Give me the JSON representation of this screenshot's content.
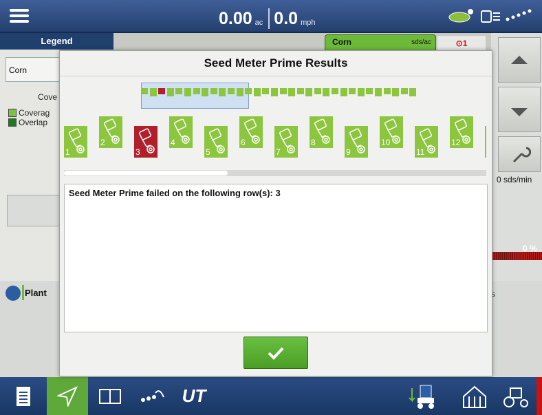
{
  "topbar": {
    "area_value": "0.00",
    "area_unit": "ac",
    "speed_value": "0.0",
    "speed_unit": "mph"
  },
  "left_panel": {
    "legend_title": "Legend",
    "crop_button": "Corn",
    "coverage_header": "Cove",
    "legend_items": [
      {
        "label": "Coverag",
        "color": "#7cc23c"
      },
      {
        "label": "Overlap",
        "color": "#1c7a1f"
      }
    ],
    "plant_label": "Plant"
  },
  "right_panel": {
    "crop_tab": "Corn",
    "crop_unit": "sds/ac",
    "pin_label": "1",
    "rate": "0 sds/min",
    "percent": "0 %",
    "s_letter": "s"
  },
  "modal": {
    "title": "Seed Meter Prime Results",
    "rows": [
      {
        "num": "1",
        "status": "ok"
      },
      {
        "num": "2",
        "status": "ok"
      },
      {
        "num": "3",
        "status": "fail"
      },
      {
        "num": "4",
        "status": "ok"
      },
      {
        "num": "5",
        "status": "ok"
      },
      {
        "num": "6",
        "status": "ok"
      },
      {
        "num": "7",
        "status": "ok"
      },
      {
        "num": "8",
        "status": "ok"
      },
      {
        "num": "9",
        "status": "ok"
      },
      {
        "num": "10",
        "status": "ok"
      },
      {
        "num": "11",
        "status": "ok"
      },
      {
        "num": "12",
        "status": "ok"
      }
    ],
    "overview_total_rows": 32,
    "overview_failed_row": 3,
    "message": "Seed Meter Prime failed on the following row(s): 3",
    "ok_icon": "checkmark-icon"
  },
  "colors": {
    "ok": "#8cc63f",
    "fail": "#b0202a",
    "accent": "#5fa83a"
  },
  "bottombar": {
    "icons": [
      "document-icon",
      "navigate-icon",
      "split-screen-icon",
      "row-control-icon",
      "ut-icon",
      "planter-icon",
      "barn-icon",
      "tractor-icon"
    ],
    "ut_label": "UT"
  }
}
